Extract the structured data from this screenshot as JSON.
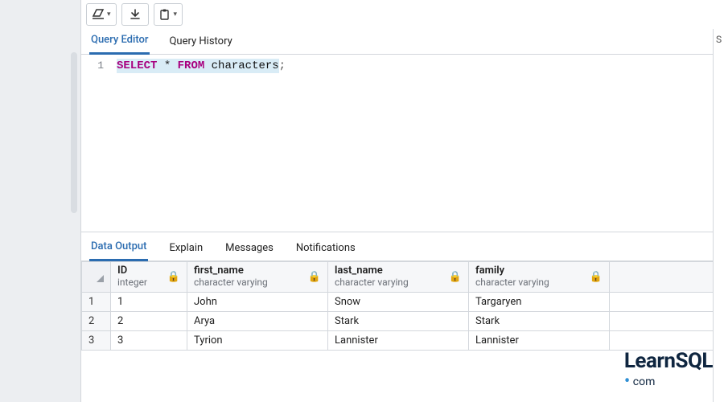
{
  "toolbar": {
    "buttons": [
      "erase",
      "download",
      "paste"
    ]
  },
  "editor_tabs": {
    "items": [
      {
        "label": "Query Editor",
        "active": true
      },
      {
        "label": "Query History",
        "active": false
      }
    ]
  },
  "editor": {
    "line_number": "1",
    "tokens": {
      "select": "SELECT",
      "star": "*",
      "from": "FROM",
      "table": "characters",
      "semicolon": ";"
    }
  },
  "result_tabs": {
    "items": [
      {
        "label": "Data Output",
        "active": true
      },
      {
        "label": "Explain",
        "active": false
      },
      {
        "label": "Messages",
        "active": false
      },
      {
        "label": "Notifications",
        "active": false
      }
    ]
  },
  "columns": [
    {
      "name": "ID",
      "type": "integer"
    },
    {
      "name": "first_name",
      "type": "character varying"
    },
    {
      "name": "last_name",
      "type": "character varying"
    },
    {
      "name": "family",
      "type": "character varying"
    }
  ],
  "rows": [
    {
      "n": "1",
      "id": "1",
      "first_name": "John",
      "last_name": "Snow",
      "family": "Targaryen"
    },
    {
      "n": "2",
      "id": "2",
      "first_name": "Arya",
      "last_name": "Stark",
      "family": "Stark"
    },
    {
      "n": "3",
      "id": "3",
      "first_name": "Tyrion",
      "last_name": "Lannister",
      "family": "Lannister"
    }
  ],
  "watermark": {
    "brand1": "Learn",
    "brand2": "SQL",
    "sub": "com"
  },
  "right_edge_char": "S"
}
